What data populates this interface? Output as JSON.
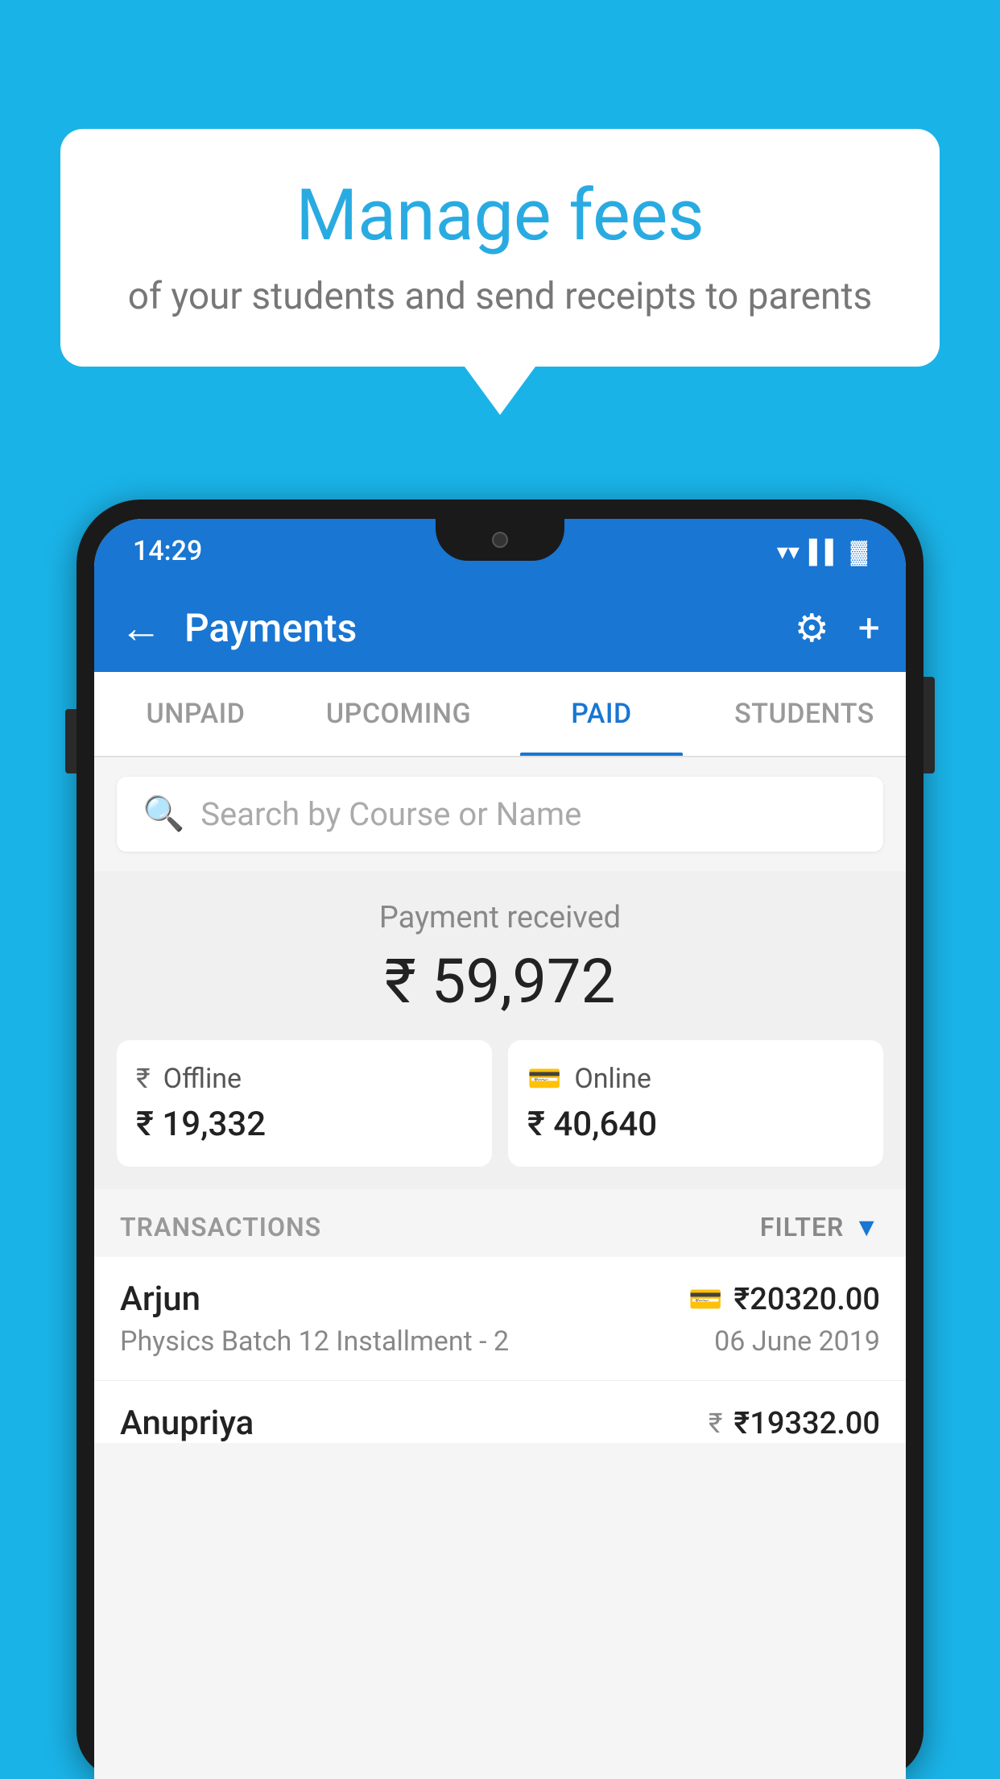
{
  "background_color": "#1ab3e8",
  "speech_bubble": {
    "title": "Manage fees",
    "subtitle": "of your students and send receipts to parents"
  },
  "phone": {
    "status_bar": {
      "time": "14:29"
    },
    "app_bar": {
      "back_label": "←",
      "title": "Payments",
      "gear_label": "⚙",
      "add_label": "+"
    },
    "tabs": [
      {
        "label": "UNPAID",
        "active": false
      },
      {
        "label": "UPCOMING",
        "active": false
      },
      {
        "label": "PAID",
        "active": true
      },
      {
        "label": "STUDENTS",
        "active": false
      }
    ],
    "search": {
      "placeholder": "Search by Course or Name"
    },
    "payment_section": {
      "label": "Payment received",
      "amount": "₹ 59,972",
      "offline_label": "Offline",
      "offline_amount": "₹ 19,332",
      "online_label": "Online",
      "online_amount": "₹ 40,640"
    },
    "transactions": {
      "header_label": "TRANSACTIONS",
      "filter_label": "FILTER",
      "rows": [
        {
          "name": "Arjun",
          "amount": "₹20320.00",
          "detail": "Physics Batch 12 Installment - 2",
          "date": "06 June 2019",
          "type_icon": "card"
        },
        {
          "name": "Anupriya",
          "amount": "₹19332.00",
          "detail": "",
          "date": "",
          "type_icon": "cash"
        }
      ]
    }
  }
}
